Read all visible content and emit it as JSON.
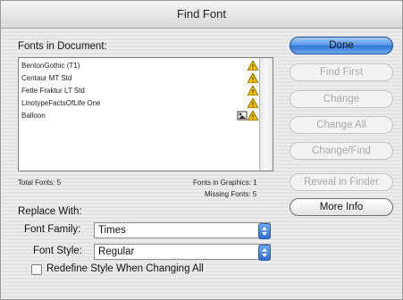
{
  "window": {
    "title": "Find Font"
  },
  "fonts_section": {
    "label": "Fonts in Document:",
    "fonts": [
      {
        "name": "BentonGothic (T1)",
        "missing": true,
        "in_graphics": false
      },
      {
        "name": "Centaur MT Std",
        "missing": true,
        "in_graphics": false
      },
      {
        "name": "Fette Fraktur LT Std",
        "missing": true,
        "in_graphics": false
      },
      {
        "name": "LinotypeFactsOfLife One",
        "missing": true,
        "in_graphics": false
      },
      {
        "name": "Balloon",
        "missing": true,
        "in_graphics": true
      }
    ],
    "total_fonts": "Total Fonts: 5",
    "fonts_in_graphics": "Fonts in Graphics: 1",
    "missing_fonts": "Missing Fonts: 5"
  },
  "replace_with": {
    "label": "Replace With:",
    "font_family_label": "Font Family:",
    "font_family_value": "Times",
    "font_style_label": "Font Style:",
    "font_style_value": "Regular",
    "redefine_label": "Redefine Style When Changing All"
  },
  "buttons": {
    "done": "Done",
    "find_first": "Find First",
    "change": "Change",
    "change_all": "Change All",
    "change_find": "Change/Find",
    "reveal_in_finder": "Reveal in Finder",
    "more_info": "More Info"
  },
  "colors": {
    "warning": "#f2c200",
    "accent": "#3f86e0"
  }
}
